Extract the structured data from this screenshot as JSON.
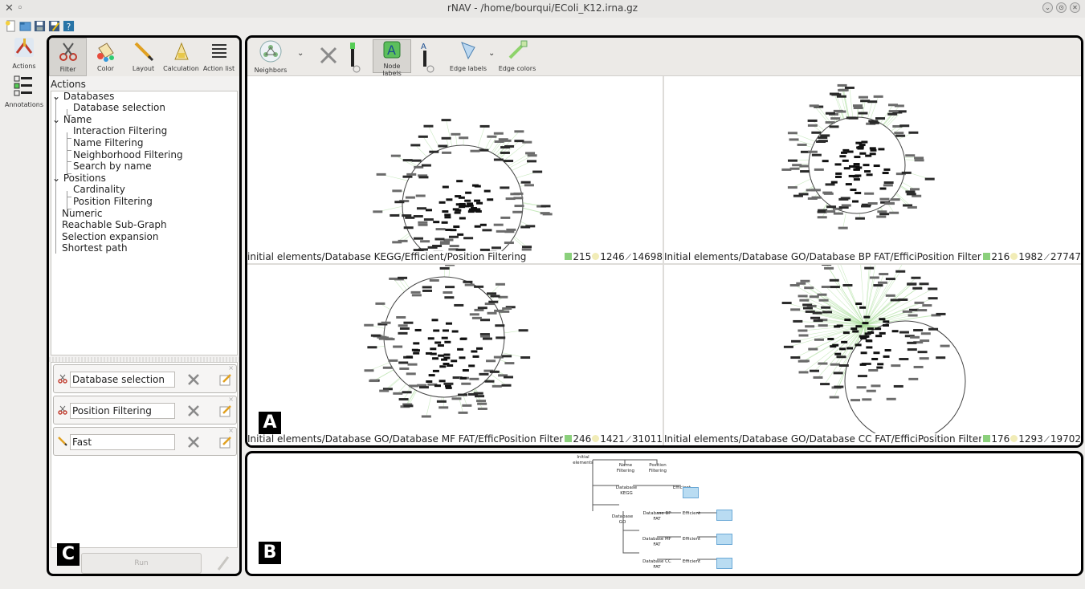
{
  "window": {
    "title": "rNAV - /home/bourqui/EColi_K12.irna.gz",
    "close_glyph": "✕",
    "min_glyph": "⌄",
    "max_glyph": "⊙",
    "closebtn_glyph": "✕"
  },
  "left_column": {
    "actions_label": "Actions",
    "annotations_label": "Annotations"
  },
  "panel_labels": {
    "a": "A",
    "b": "B",
    "c": "C"
  },
  "panel_c": {
    "tabs": [
      {
        "label": "Filter",
        "icon": "scissors-icon"
      },
      {
        "label": "Color",
        "icon": "paint-bucket-icon"
      },
      {
        "label": "Layout",
        "icon": "pencil-icon"
      },
      {
        "label": "Calculation",
        "icon": "calculator-icon"
      },
      {
        "label": "Action list",
        "icon": "list-icon"
      }
    ],
    "actions_heading": "Actions",
    "tree": [
      {
        "label": "Databases",
        "level": 0,
        "expanded": true
      },
      {
        "label": "Database selection",
        "level": 1
      },
      {
        "label": "Name",
        "level": 0,
        "expanded": true
      },
      {
        "label": "Interaction Filtering",
        "level": 1
      },
      {
        "label": "Name Filtering",
        "level": 1
      },
      {
        "label": "Neighborhood Filtering",
        "level": 1
      },
      {
        "label": "Search by name",
        "level": 1
      },
      {
        "label": "Positions",
        "level": 0,
        "expanded": true
      },
      {
        "label": "Cardinality",
        "level": 1
      },
      {
        "label": "Position Filtering",
        "level": 1
      },
      {
        "label": "Numeric",
        "level": 0
      },
      {
        "label": "Reachable Sub-Graph",
        "level": 0
      },
      {
        "label": "Selection expansion",
        "level": 0
      },
      {
        "label": "Shortest path",
        "level": 0
      }
    ],
    "action_cards": [
      {
        "label": "Database selection",
        "icon": "scissors-icon"
      },
      {
        "label": "Position Filtering",
        "icon": "scissors-icon"
      },
      {
        "label": "Fast",
        "icon": "pencil-icon"
      }
    ],
    "run_label": "Run"
  },
  "panel_a": {
    "toolbar": [
      {
        "label": "Neighbors",
        "icon": "neighbors-icon"
      },
      {
        "label": "Node labels",
        "icon": "node-labels-icon"
      },
      {
        "label": "Edge labels",
        "icon": "edge-labels-icon"
      },
      {
        "label": "Edge colors",
        "icon": "edge-colors-icon"
      }
    ],
    "views": [
      {
        "caption": "initial elements/Database KEGG/Efficient/Position Filtering",
        "nodes": "215",
        "sub": "1246",
        "edges": "14698"
      },
      {
        "caption": "Initial elements/Database GO/Database BP FAT/EfficiPosition Filtering",
        "nodes": "216",
        "sub": "1982",
        "edges": "27747"
      },
      {
        "caption": "Initial elements/Database GO/Database MF FAT/EfficPosition Filtering",
        "nodes": "246",
        "sub": "1421",
        "edges": "31011"
      },
      {
        "caption": "Initial elements/Database GO/Database CC FAT/EfficiPosition Filtering",
        "nodes": "176",
        "sub": "1293",
        "edges": "19702"
      }
    ]
  },
  "panel_b": {
    "nodes": {
      "initial": "Initial elements",
      "name_filtering": "Name Filtering",
      "position_filtering": "Position Filtering",
      "db_kegg": "Database KEGG",
      "efficient": "Efficient",
      "db_go": "Database GO",
      "db_bp": "Database BP FAT",
      "db_mf": "Database MF FAT",
      "db_cc": "Database CC FAT",
      "position_short": "Position Filtering"
    }
  }
}
